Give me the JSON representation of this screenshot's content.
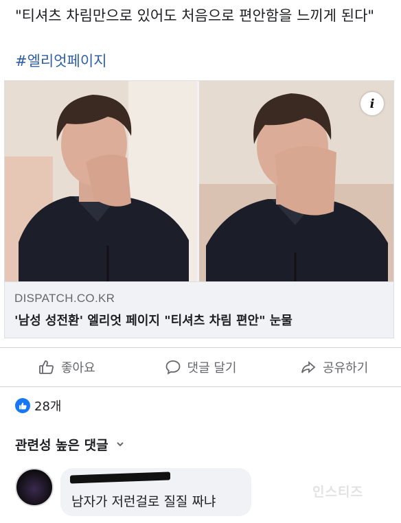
{
  "post": {
    "text": "\"티셔츠 차림만으로 있어도 처음으로 편안함을 느끼게 된다\"",
    "hashtag": "#엘리엇페이지"
  },
  "link_card": {
    "info_badge": "i",
    "source": "DISPATCH.CO.KR",
    "headline": "'남성 성전환' 엘리엇 페이지 \"티셔츠 차림 편안\" 눈물"
  },
  "actions": {
    "like": "좋아요",
    "comment": "댓글 달기",
    "share": "공유하기"
  },
  "reactions": {
    "count": "28개"
  },
  "comments": {
    "sort_label": "관련성 높은 댓글",
    "items": [
      {
        "text": "남자가 저런걸로 질질 짜냐"
      }
    ]
  },
  "watermark": "인스티즈",
  "colors": {
    "accent": "#1877f2",
    "hashtag": "#2d5ea8",
    "muted_text": "#65676b",
    "card_bg": "#f0f2f5"
  }
}
